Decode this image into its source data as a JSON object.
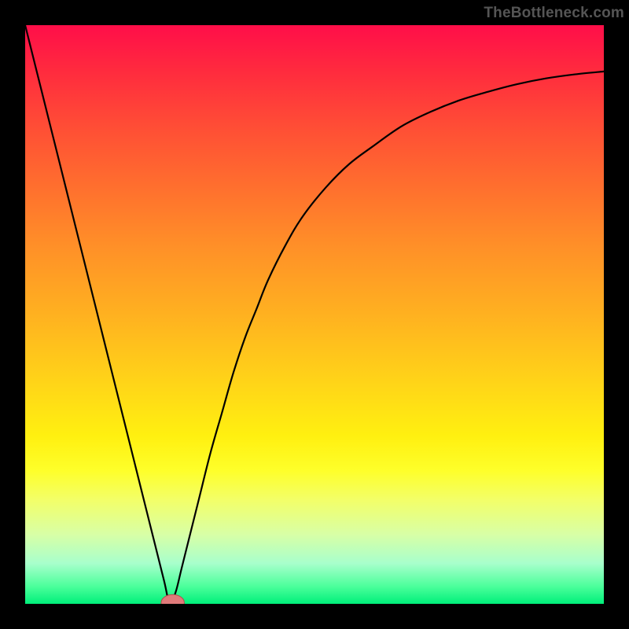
{
  "watermark": "TheBottleneck.com",
  "chart_data": {
    "type": "line",
    "title": "",
    "xlabel": "",
    "ylabel": "",
    "xlim": [
      0,
      100
    ],
    "ylim": [
      0,
      100
    ],
    "series": [
      {
        "name": "curve",
        "x": [
          0,
          3,
          6,
          9,
          12,
          15,
          18,
          20,
          22,
          24,
          25,
          26,
          27,
          28,
          30,
          32,
          34,
          36,
          38,
          40,
          42,
          45,
          48,
          52,
          56,
          60,
          65,
          70,
          75,
          80,
          85,
          90,
          95,
          100
        ],
        "values": [
          100,
          88,
          76,
          64,
          52,
          40,
          28,
          20,
          12,
          4,
          0,
          2,
          6,
          10,
          18,
          26,
          33,
          40,
          46,
          51,
          56,
          62,
          67,
          72,
          76,
          79,
          82.5,
          85,
          87,
          88.5,
          89.8,
          90.8,
          91.5,
          92
        ]
      }
    ],
    "marker": {
      "x": 25.5,
      "y": 0.2,
      "rx": 2.0,
      "ry": 1.4
    },
    "background_gradient": {
      "top": "#ff0e49",
      "mid": "#ffd518",
      "bottom": "#00ef7a"
    }
  }
}
